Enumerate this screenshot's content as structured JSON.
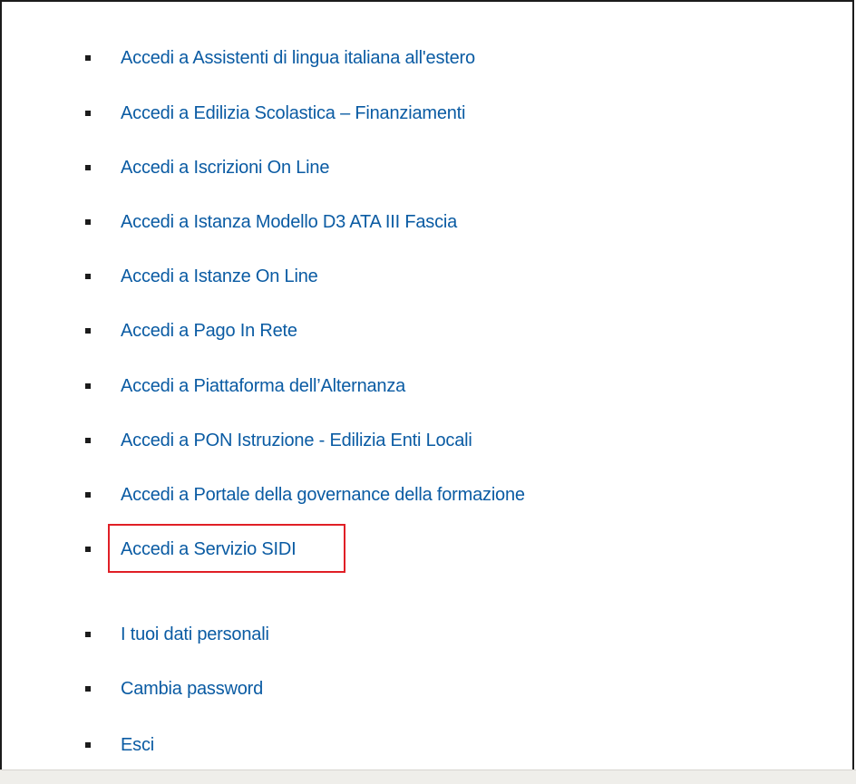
{
  "links": [
    {
      "label": "Accedi a Assistenti di lingua italiana all'estero"
    },
    {
      "label": "Accedi a Edilizia Scolastica – Finanziamenti"
    },
    {
      "label": "Accedi a Iscrizioni On Line"
    },
    {
      "label": "Accedi a Istanza Modello D3 ATA III Fascia"
    },
    {
      "label": "Accedi a Istanze On Line"
    },
    {
      "label": "Accedi a Pago In Rete"
    },
    {
      "label": "Accedi a Piattaforma dell’Alternanza"
    },
    {
      "label": "Accedi a PON Istruzione - Edilizia Enti Locali"
    },
    {
      "label": "Accedi a Portale della governance della formazione"
    },
    {
      "label": "Accedi a Servizio SIDI"
    }
  ],
  "account_links": [
    {
      "label": "I tuoi dati personali"
    },
    {
      "label": "Cambia password"
    },
    {
      "label": "Esci"
    }
  ],
  "colors": {
    "link": "#0a5ba3",
    "highlight_border": "#e01f26",
    "frame_border": "#1b1b1b"
  }
}
